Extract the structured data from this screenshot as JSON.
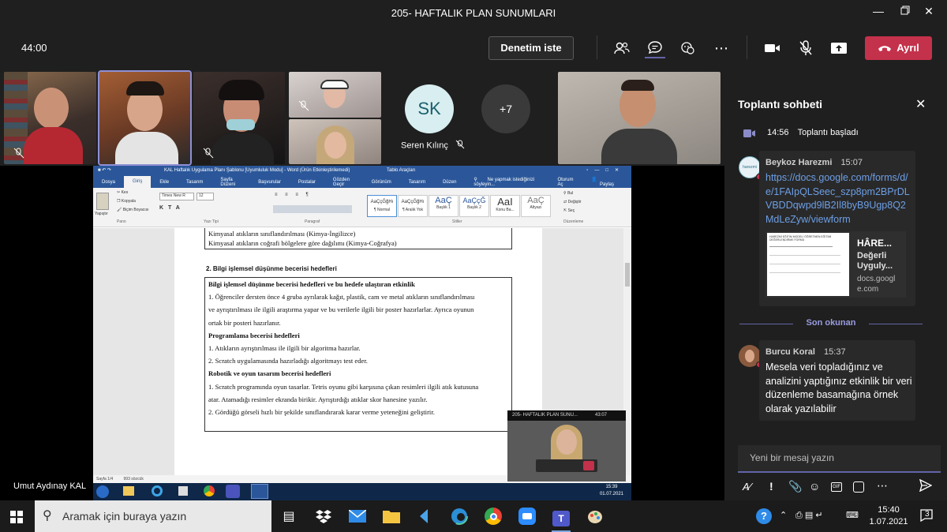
{
  "window": {
    "title": "205- HAFTALIK PLAN SUNUMLARI",
    "controls": [
      "minimize-icon",
      "maximize-icon",
      "close-icon"
    ]
  },
  "toolbar": {
    "timer": "44:00",
    "request_control": "Denetim iste",
    "leave": "Ayrıl",
    "icons": [
      "people-icon",
      "chat-icon",
      "reactions-icon",
      "more-icon",
      "camera-icon",
      "mic-off-icon",
      "share-icon",
      "phone-icon"
    ]
  },
  "participants": {
    "seren": {
      "initials": "SK",
      "name": "Seren Kılınç"
    },
    "overflow": "+7"
  },
  "word": {
    "title": "KAL Haftalık Uygulama Planı Şablonu [Uyumluluk Modu] - Word (Ürün Etkinleştirilemedi)",
    "table_tools": "Tablo Araçları",
    "tabs": [
      "Dosya",
      "Giriş",
      "Ekle",
      "Tasarım",
      "Sayfa Düzeni",
      "Başvurular",
      "Postalar",
      "Gözden Geçir",
      "Görünüm",
      "Tasarım",
      "Düzen"
    ],
    "tell_me": "Ne yapmak istediğinizi söyleyin...",
    "user": "Oturum Aç",
    "share": "Paylaş",
    "clipboard": {
      "paste": "Yapıştır",
      "cut": "Kes",
      "copy": "Kopyala",
      "format_painter": "Biçim Boyacısı",
      "group": "Pano"
    },
    "font": {
      "name": "Times New R",
      "size": "12",
      "group": "Yazı Tipi"
    },
    "paragraph_group": "Paragraf",
    "styles_group": "Stiller",
    "editing": {
      "find": "Bul",
      "replace": "Değiştir",
      "select": "Seç",
      "group": "Düzenleme"
    },
    "styles": [
      {
        "preview": "AaÇçĞğHı",
        "name": "¶ Normal"
      },
      {
        "preview": "AaÇçĞğHı",
        "name": "¶ Aralık Yok"
      },
      {
        "preview": "AaÇ",
        "name": "Başlık 1"
      },
      {
        "preview": "AaÇçĞ",
        "name": "Başlık 2"
      },
      {
        "preview": "AaI",
        "name": "Konu Ba..."
      },
      {
        "preview": "AaÇ",
        "name": "Altyazı"
      }
    ],
    "doc": {
      "top_lines": [
        "Kimyasal atıkların sınıflandırılması (Kimya-İngilizce)",
        "Kimyasal atıkların coğrafi bölgelere göre dağılımı (Kimya-Coğrafya)"
      ],
      "section_title": "2. Bilgi işlemsel düşünme becerisi hedefleri",
      "lines": [
        {
          "text": "Bilgi işlemsel düşünme becerisi hedefleri ve bu hedefe ulaştıran etkinlik",
          "bold": true
        },
        {
          "text": "1.  Öğrenciler dersten önce 4 gruba ayrılarak kağıt, plastik, cam ve metal atıkların sınıflandırılması",
          "bold": false
        },
        {
          "text": "ve ayrıştırılması ile ilgili araştırma yapar ve bu verilerle ilgili bir poster hazırlarlar. Ayrıca oyunun",
          "bold": false
        },
        {
          "text": "ortak bir posteri hazırlanır.",
          "bold": false
        },
        {
          "text": "Programlama becerisi hedefleri",
          "bold": true
        },
        {
          "text": "1.  Atıkların ayrıştırılması ile ilgili bir algoritma hazırlar.",
          "bold": false
        },
        {
          "text": "2. Scratch uygulamasında hazırladığı algoritmayı test eder.",
          "bold": false
        },
        {
          "text": "Robotik ve oyun tasarım becerisi hedefleri",
          "bold": true
        },
        {
          "text": "1.  Scratch programında oyun tasarlar. Tetris oyunu gibi karşısına çıkan resimleri ilgili atık kutusuna",
          "bold": false
        },
        {
          "text": "atar. Atamadığı resimler ekranda birikir. Ayrıştırdığı atıklar skor hanesine yazılır.",
          "bold": false
        },
        {
          "text": "2. Gördüğü görseli hızlı bir şekilde sınıflandırarak karar verme yeteneğini geliştirir.",
          "bold": false
        }
      ]
    },
    "status": {
      "page": "Sayfa 1/4",
      "words": "993 sözcük"
    },
    "tray_time": "15:39",
    "tray_date": "01.07.2021"
  },
  "pip": {
    "title": "205- HAFTALIK PLAN SUNU...",
    "time": "43:07"
  },
  "presenter_name": "Umut Aydınay KAL",
  "chat": {
    "title": "Toplantı sohbeti",
    "meeting_started": {
      "time": "14:56",
      "text": "Toplantı başladı"
    },
    "messages": [
      {
        "author": "Beykoz Harezmi",
        "time": "15:07",
        "link": "https://docs.google.com/forms/d/e/1FAIpQLSeec_szp8pm2BPrDLVBDDqwpd9lB2Il8byB9Ugp8Q2MdLeZyw/viewform",
        "preview": {
          "title": "HÂRE...",
          "desc": "Değerli Uyguly...",
          "domain": "docs.google.com",
          "thumb_title": "HAREZMİ EĞİTİM MODELİ ÖĞRETMEN EĞİTİMİ DEĞERLENDİRME FORMU"
        }
      },
      {
        "author": "Burcu Koral",
        "time": "15:37",
        "text": "Mesela veri topladığınız ve analizini yaptığınız etkinlik bir veri düzenleme basamağına örnek olarak yazılabilir"
      }
    ],
    "last_read": "Son okunan",
    "compose_placeholder": "Yeni bir mesaj yazın",
    "compose_tools": [
      "format-icon",
      "important-icon",
      "attach-icon",
      "emoji-icon",
      "gif-icon",
      "sticker-icon",
      "more-icon",
      "send-icon"
    ]
  },
  "taskbar": {
    "search_placeholder": "Aramak için buraya yazın",
    "time": "15:40",
    "date": "1.07.2021",
    "notifications": "3"
  },
  "colors": {
    "accent": "#6264a7",
    "leave": "#c4314b",
    "word_blue": "#2b579a",
    "bg": "#1f1f1f"
  }
}
